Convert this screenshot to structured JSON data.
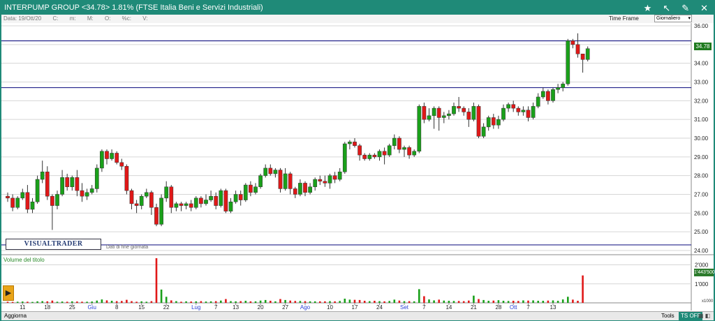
{
  "window": {
    "title": "INTERPUMP GROUP <34.78> 1.81%  (FTSE Italia Beni e Servizi Industriali)"
  },
  "toolbar": {
    "date": "Data: 19/Ott/20",
    "c": "C:",
    "m": "m:",
    "M": "M:",
    "o": "O:",
    "pct": "%c:",
    "v": "V:"
  },
  "timeframe": {
    "label": "Time Frame",
    "selected": "Giornaliero"
  },
  "bottom": {
    "update": "Aggiorna",
    "tools": "Tools",
    "ts_off": "TS OFF"
  },
  "logo": {
    "text": "VISUALTRADER",
    "subtitle": "Dati di fine giornata"
  },
  "volume_panel": {
    "title": "Volume del titolo"
  },
  "badges": {
    "price": "34.78",
    "volume": "1'443'500",
    "vol_scale": "x1000"
  },
  "colors": {
    "up": "#1aa01a",
    "down": "#e01818",
    "hline": "#23238a",
    "grid": "#d6d6d6"
  },
  "chart_data": {
    "type": "candlestick",
    "price_axis": {
      "min": 24.0,
      "max": 36.0,
      "ticks": [
        "24.00",
        "25.00",
        "26.00",
        "27.00",
        "28.00",
        "29.00",
        "30.00",
        "31.00",
        "32.00",
        "33.00",
        "34.00",
        "35.00",
        "36.00"
      ]
    },
    "volume_axis": {
      "max": 2000,
      "ticks": [
        "1'000",
        "2'000"
      ]
    },
    "horizontal_lines": [
      35.2,
      32.7,
      24.3
    ],
    "x_labels": [
      {
        "i": 3,
        "t": "11",
        "m": false
      },
      {
        "i": 8,
        "t": "18",
        "m": false
      },
      {
        "i": 13,
        "t": "25",
        "m": false
      },
      {
        "i": 17,
        "t": "Giu",
        "m": true
      },
      {
        "i": 22,
        "t": "8",
        "m": false
      },
      {
        "i": 27,
        "t": "15",
        "m": false
      },
      {
        "i": 32,
        "t": "22",
        "m": false
      },
      {
        "i": 38,
        "t": "Lug",
        "m": true
      },
      {
        "i": 42,
        "t": "7",
        "m": false
      },
      {
        "i": 46,
        "t": "13",
        "m": false
      },
      {
        "i": 51,
        "t": "20",
        "m": false
      },
      {
        "i": 56,
        "t": "27",
        "m": false
      },
      {
        "i": 60,
        "t": "Ago",
        "m": true
      },
      {
        "i": 65,
        "t": "10",
        "m": false
      },
      {
        "i": 70,
        "t": "17",
        "m": false
      },
      {
        "i": 75,
        "t": "24",
        "m": false
      },
      {
        "i": 80,
        "t": "Set",
        "m": true
      },
      {
        "i": 84,
        "t": "7",
        "m": false
      },
      {
        "i": 89,
        "t": "14",
        "m": false
      },
      {
        "i": 94,
        "t": "21",
        "m": false
      },
      {
        "i": 99,
        "t": "28",
        "m": false
      },
      {
        "i": 102,
        "t": "Ott",
        "m": true
      },
      {
        "i": 105,
        "t": "7",
        "m": false
      },
      {
        "i": 110,
        "t": "13",
        "m": false
      }
    ],
    "candles": [
      [
        26.9,
        26.8,
        27.1,
        26.6
      ],
      [
        26.8,
        26.3,
        27.0,
        26.1
      ],
      [
        26.3,
        26.8,
        26.9,
        26.2
      ],
      [
        26.8,
        27.1,
        27.3,
        26.7
      ],
      [
        27.1,
        26.2,
        27.5,
        26.0
      ],
      [
        26.2,
        26.6,
        26.8,
        26.0
      ],
      [
        26.6,
        27.8,
        28.0,
        26.5
      ],
      [
        27.8,
        28.2,
        28.8,
        27.6
      ],
      [
        28.2,
        26.9,
        28.5,
        26.7
      ],
      [
        26.9,
        26.4,
        27.0,
        25.1
      ],
      [
        26.4,
        27.0,
        27.2,
        26.2
      ],
      [
        27.0,
        27.9,
        28.3,
        26.9
      ],
      [
        27.9,
        27.4,
        28.1,
        27.2
      ],
      [
        27.4,
        27.9,
        28.0,
        27.2
      ],
      [
        27.9,
        27.2,
        28.3,
        26.9
      ],
      [
        27.2,
        26.9,
        27.6,
        26.6
      ],
      [
        26.9,
        27.1,
        27.3,
        26.7
      ],
      [
        27.1,
        27.3,
        27.5,
        27.0
      ],
      [
        27.3,
        28.4,
        28.6,
        27.1
      ],
      [
        28.4,
        29.3,
        29.4,
        28.2
      ],
      [
        29.3,
        28.9,
        29.4,
        28.6
      ],
      [
        28.9,
        29.2,
        29.4,
        28.8
      ],
      [
        29.2,
        28.7,
        29.3,
        28.6
      ],
      [
        28.7,
        28.5,
        28.9,
        28.3
      ],
      [
        28.5,
        27.2,
        28.6,
        27.0
      ],
      [
        27.2,
        26.5,
        27.3,
        26.2
      ],
      [
        26.5,
        26.4,
        26.7,
        26.0
      ],
      [
        26.4,
        26.9,
        27.0,
        26.2
      ],
      [
        26.9,
        27.1,
        27.3,
        26.8
      ],
      [
        27.1,
        26.3,
        27.2,
        25.9
      ],
      [
        26.3,
        25.4,
        26.5,
        25.3
      ],
      [
        25.4,
        26.8,
        27.0,
        25.3
      ],
      [
        26.8,
        27.4,
        27.7,
        26.6
      ],
      [
        27.4,
        26.3,
        27.5,
        26.0
      ],
      [
        26.3,
        26.5,
        26.6,
        26.1
      ],
      [
        26.5,
        26.4,
        26.6,
        26.1
      ],
      [
        26.4,
        26.5,
        26.6,
        26.2
      ],
      [
        26.5,
        26.3,
        26.7,
        26.1
      ],
      [
        26.3,
        26.8,
        26.9,
        26.2
      ],
      [
        26.8,
        26.5,
        26.9,
        26.3
      ],
      [
        26.5,
        26.7,
        27.0,
        26.4
      ],
      [
        26.7,
        26.9,
        27.2,
        26.6
      ],
      [
        26.9,
        26.4,
        27.1,
        26.2
      ],
      [
        26.4,
        27.2,
        27.3,
        26.3
      ],
      [
        27.2,
        26.1,
        27.3,
        26.0
      ],
      [
        26.1,
        26.6,
        26.8,
        26.0
      ],
      [
        26.6,
        27.0,
        27.2,
        26.5
      ],
      [
        27.0,
        26.7,
        27.2,
        26.4
      ],
      [
        26.7,
        27.5,
        27.6,
        26.6
      ],
      [
        27.5,
        27.1,
        27.7,
        26.9
      ],
      [
        27.1,
        27.4,
        27.6,
        27.0
      ],
      [
        27.4,
        28.0,
        28.1,
        27.3
      ],
      [
        28.0,
        28.4,
        28.6,
        27.9
      ],
      [
        28.4,
        28.1,
        28.6,
        28.0
      ],
      [
        28.1,
        28.3,
        28.4,
        27.9
      ],
      [
        28.3,
        27.3,
        28.4,
        27.1
      ],
      [
        27.3,
        28.1,
        28.4,
        27.2
      ],
      [
        28.1,
        27.3,
        28.2,
        27.0
      ],
      [
        27.3,
        27.0,
        27.4,
        26.8
      ],
      [
        27.0,
        27.6,
        27.8,
        26.9
      ],
      [
        27.6,
        27.1,
        27.7,
        26.9
      ],
      [
        27.1,
        27.4,
        27.6,
        27.0
      ],
      [
        27.4,
        27.8,
        27.9,
        27.2
      ],
      [
        27.8,
        27.7,
        28.0,
        27.5
      ],
      [
        27.7,
        27.6,
        28.0,
        27.4
      ],
      [
        27.6,
        28.0,
        28.1,
        27.3
      ],
      [
        28.0,
        27.8,
        28.2,
        27.6
      ],
      [
        27.8,
        28.2,
        28.4,
        27.7
      ],
      [
        28.2,
        29.7,
        29.8,
        28.1
      ],
      [
        29.7,
        29.8,
        29.9,
        29.4
      ],
      [
        29.8,
        29.6,
        30.0,
        29.5
      ],
      [
        29.6,
        29.1,
        29.7,
        28.8
      ],
      [
        29.1,
        28.9,
        29.2,
        28.8
      ],
      [
        28.9,
        29.1,
        29.2,
        28.8
      ],
      [
        29.1,
        29.0,
        29.2,
        28.9
      ],
      [
        29.0,
        29.3,
        29.4,
        28.8
      ],
      [
        29.3,
        29.1,
        29.5,
        28.6
      ],
      [
        29.1,
        29.6,
        29.7,
        29.0
      ],
      [
        29.6,
        30.0,
        30.2,
        29.4
      ],
      [
        30.0,
        29.4,
        30.1,
        29.2
      ],
      [
        29.4,
        29.5,
        29.6,
        29.0
      ],
      [
        29.5,
        29.1,
        29.6,
        28.9
      ],
      [
        29.1,
        29.3,
        29.4,
        29.0
      ],
      [
        29.3,
        31.7,
        31.8,
        29.2
      ],
      [
        31.7,
        31.0,
        31.9,
        30.8
      ],
      [
        31.0,
        31.2,
        31.6,
        30.9
      ],
      [
        31.2,
        31.6,
        31.7,
        30.5
      ],
      [
        31.6,
        31.1,
        31.7,
        30.4
      ],
      [
        31.1,
        31.2,
        31.4,
        30.8
      ],
      [
        31.2,
        31.3,
        31.5,
        31.0
      ],
      [
        31.3,
        31.7,
        31.9,
        31.2
      ],
      [
        31.7,
        31.6,
        32.2,
        31.4
      ],
      [
        31.6,
        31.4,
        31.7,
        31.2
      ],
      [
        31.4,
        31.0,
        31.6,
        30.6
      ],
      [
        31.0,
        31.7,
        31.9,
        30.9
      ],
      [
        31.7,
        30.1,
        31.8,
        30.0
      ],
      [
        30.1,
        30.6,
        30.8,
        30.0
      ],
      [
        30.6,
        31.1,
        31.2,
        30.4
      ],
      [
        31.1,
        30.7,
        31.3,
        30.5
      ],
      [
        30.7,
        31.0,
        31.2,
        30.5
      ],
      [
        31.0,
        31.6,
        31.8,
        30.9
      ],
      [
        31.6,
        31.8,
        31.9,
        31.4
      ],
      [
        31.8,
        31.6,
        32.0,
        31.4
      ],
      [
        31.6,
        31.4,
        31.7,
        31.2
      ],
      [
        31.4,
        31.5,
        31.7,
        31.2
      ],
      [
        31.5,
        31.1,
        31.7,
        30.9
      ],
      [
        31.1,
        31.7,
        31.9,
        31.0
      ],
      [
        31.7,
        32.2,
        32.4,
        31.6
      ],
      [
        32.2,
        32.5,
        32.7,
        32.1
      ],
      [
        32.5,
        32.0,
        32.6,
        31.8
      ],
      [
        32.0,
        32.6,
        32.7,
        31.9
      ],
      [
        32.6,
        32.7,
        32.9,
        32.4
      ],
      [
        32.7,
        32.9,
        33.0,
        32.5
      ],
      [
        32.9,
        35.2,
        35.3,
        32.8
      ],
      [
        35.2,
        35.0,
        35.3,
        34.8
      ],
      [
        35.0,
        34.5,
        35.6,
        34.3
      ],
      [
        34.5,
        34.2,
        34.4,
        33.5
      ],
      [
        34.2,
        34.78,
        34.9,
        34.1
      ]
    ],
    "volumes": [
      60,
      50,
      60,
      70,
      60,
      50,
      80,
      90,
      80,
      120,
      60,
      70,
      60,
      80,
      70,
      60,
      60,
      70,
      120,
      180,
      130,
      110,
      90,
      100,
      160,
      90,
      60,
      80,
      60,
      90,
      2350,
      700,
      320,
      130,
      90,
      60,
      80,
      70,
      80,
      90,
      70,
      80,
      90,
      120,
      200,
      90,
      80,
      90,
      110,
      80,
      80,
      120,
      150,
      110,
      80,
      200,
      150,
      120,
      100,
      100,
      90,
      80,
      80,
      80,
      80,
      90,
      80,
      100,
      220,
      170,
      160,
      150,
      110,
      90,
      110,
      90,
      80,
      100,
      170,
      120,
      90,
      90,
      80,
      720,
      350,
      180,
      130,
      170,
      120,
      110,
      100,
      100,
      90,
      120,
      380,
      200,
      150,
      110,
      120,
      140,
      110,
      100,
      110,
      100,
      130,
      120,
      130,
      110,
      110,
      120,
      130,
      110,
      180,
      320,
      170,
      110,
      1443
    ]
  }
}
